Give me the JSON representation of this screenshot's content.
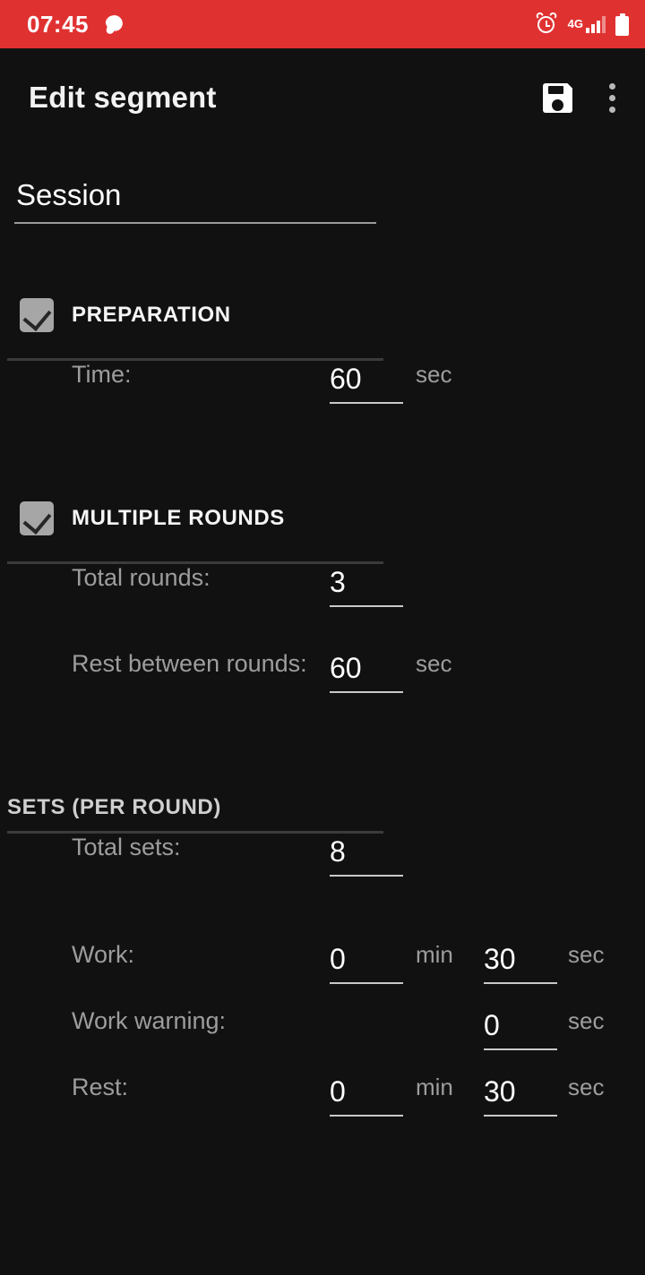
{
  "status_bar": {
    "time": "07:45",
    "notification_icon": "speech-bubble-icon",
    "alarm_icon": "alarm-clock-icon",
    "network_label": "4G",
    "signal_icon": "signal-bars-icon",
    "battery_icon": "battery-icon",
    "background_color": "#e03131"
  },
  "app_bar": {
    "title": "Edit segment",
    "save_icon": "save-floppy-icon",
    "overflow_icon": "kebab-menu-icon"
  },
  "form": {
    "name": {
      "value": "Session",
      "placeholder": "Name"
    },
    "preparation": {
      "title": "PREPARATION",
      "checked": true,
      "rows": [
        {
          "label": "Time:",
          "value": "60",
          "unit": "sec"
        }
      ]
    },
    "multiple_rounds": {
      "title": "MULTIPLE ROUNDS",
      "checked": true,
      "rows": [
        {
          "label": "Total rounds:",
          "value": "3",
          "unit": ""
        },
        {
          "label": "Rest between rounds:",
          "value": "60",
          "unit": "sec"
        }
      ]
    },
    "sets": {
      "title": "SETS (PER ROUND)",
      "rows": [
        {
          "label": "Total sets:",
          "value": "8",
          "unit": ""
        },
        {
          "label": "Work:",
          "min_value": "0",
          "min_unit": "min",
          "sec_value": "30",
          "sec_unit": "sec"
        },
        {
          "label": "Work warning:",
          "sec_value": "0",
          "sec_unit": "sec"
        },
        {
          "label": "Rest:",
          "min_value": "0",
          "min_unit": "min",
          "sec_value": "30",
          "sec_unit": "sec"
        }
      ]
    }
  },
  "colors": {
    "background": "#111111",
    "accent": "#e03131",
    "checkbox": "#a6a6a6",
    "label_text": "#9d9d9d",
    "value_text": "#ffffff",
    "divider": "#3b3b3b"
  }
}
